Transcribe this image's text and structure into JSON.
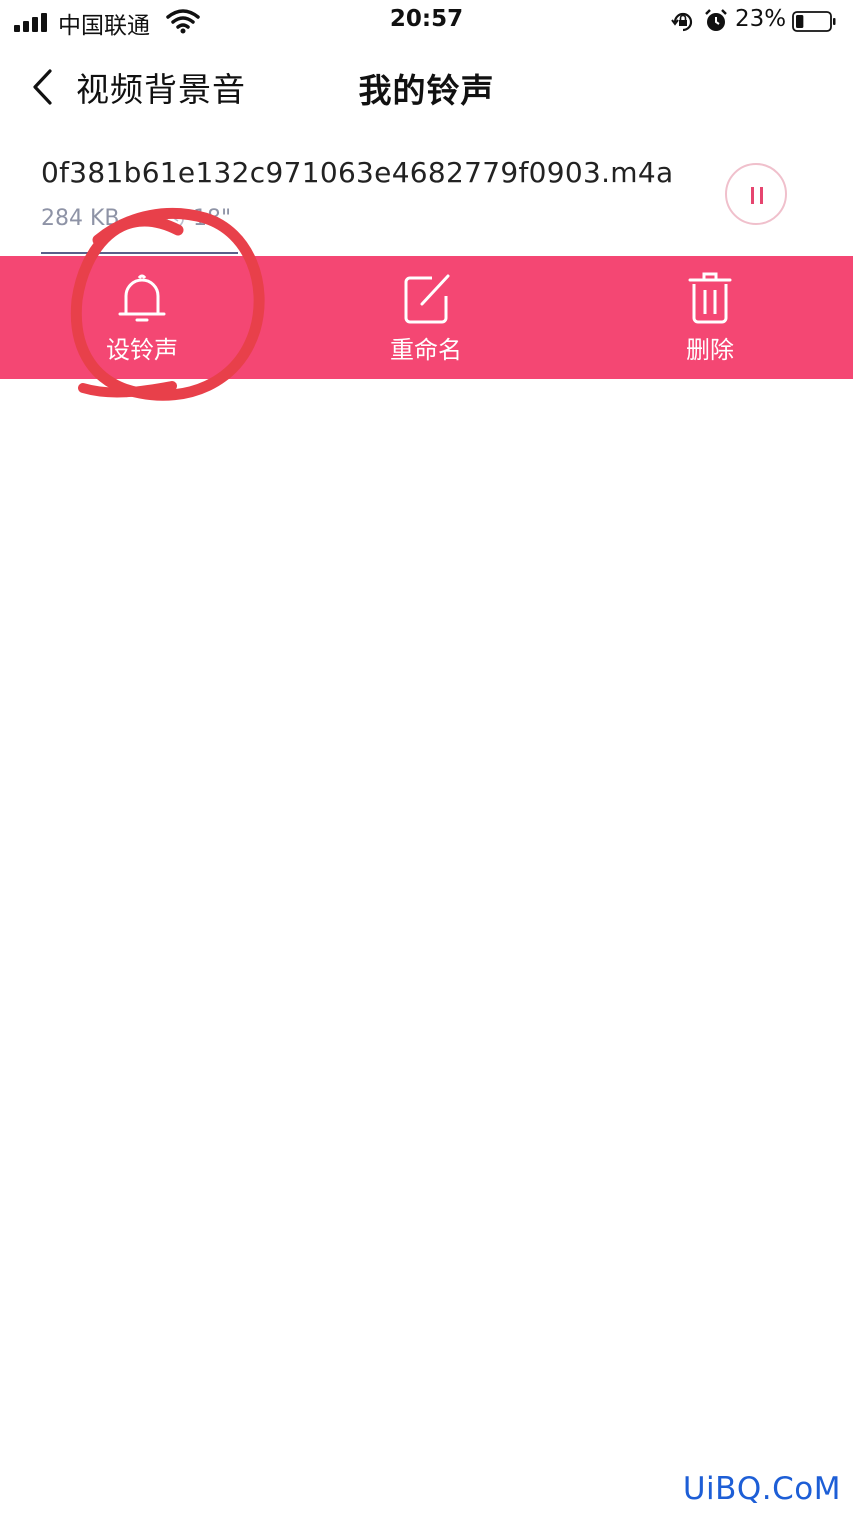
{
  "status_bar": {
    "carrier": "中国联通",
    "time": "20:57",
    "battery_percent": "23%",
    "battery_level": 0.23,
    "icons": [
      "signal-icon",
      "wifi-icon",
      "rotation-lock-icon",
      "alarm-icon",
      "battery-icon"
    ]
  },
  "nav": {
    "back_label": "视频背景音",
    "title": "我的铃声"
  },
  "file_item": {
    "name": "0f381b61e132c971063e4682779f0903.m4a",
    "size": "284 KB",
    "duration": "18\"",
    "pause_icon": "pause-icon"
  },
  "actions": [
    {
      "label": "设铃声",
      "icon": "bell-icon"
    },
    {
      "label": "重命名",
      "icon": "edit-icon"
    },
    {
      "label": "删除",
      "icon": "trash-icon"
    }
  ],
  "colors": {
    "accent": "#f44773",
    "annotation": "#e8404a",
    "watermark": "#1d5ed6"
  },
  "watermark": "UiBQ.CoM"
}
